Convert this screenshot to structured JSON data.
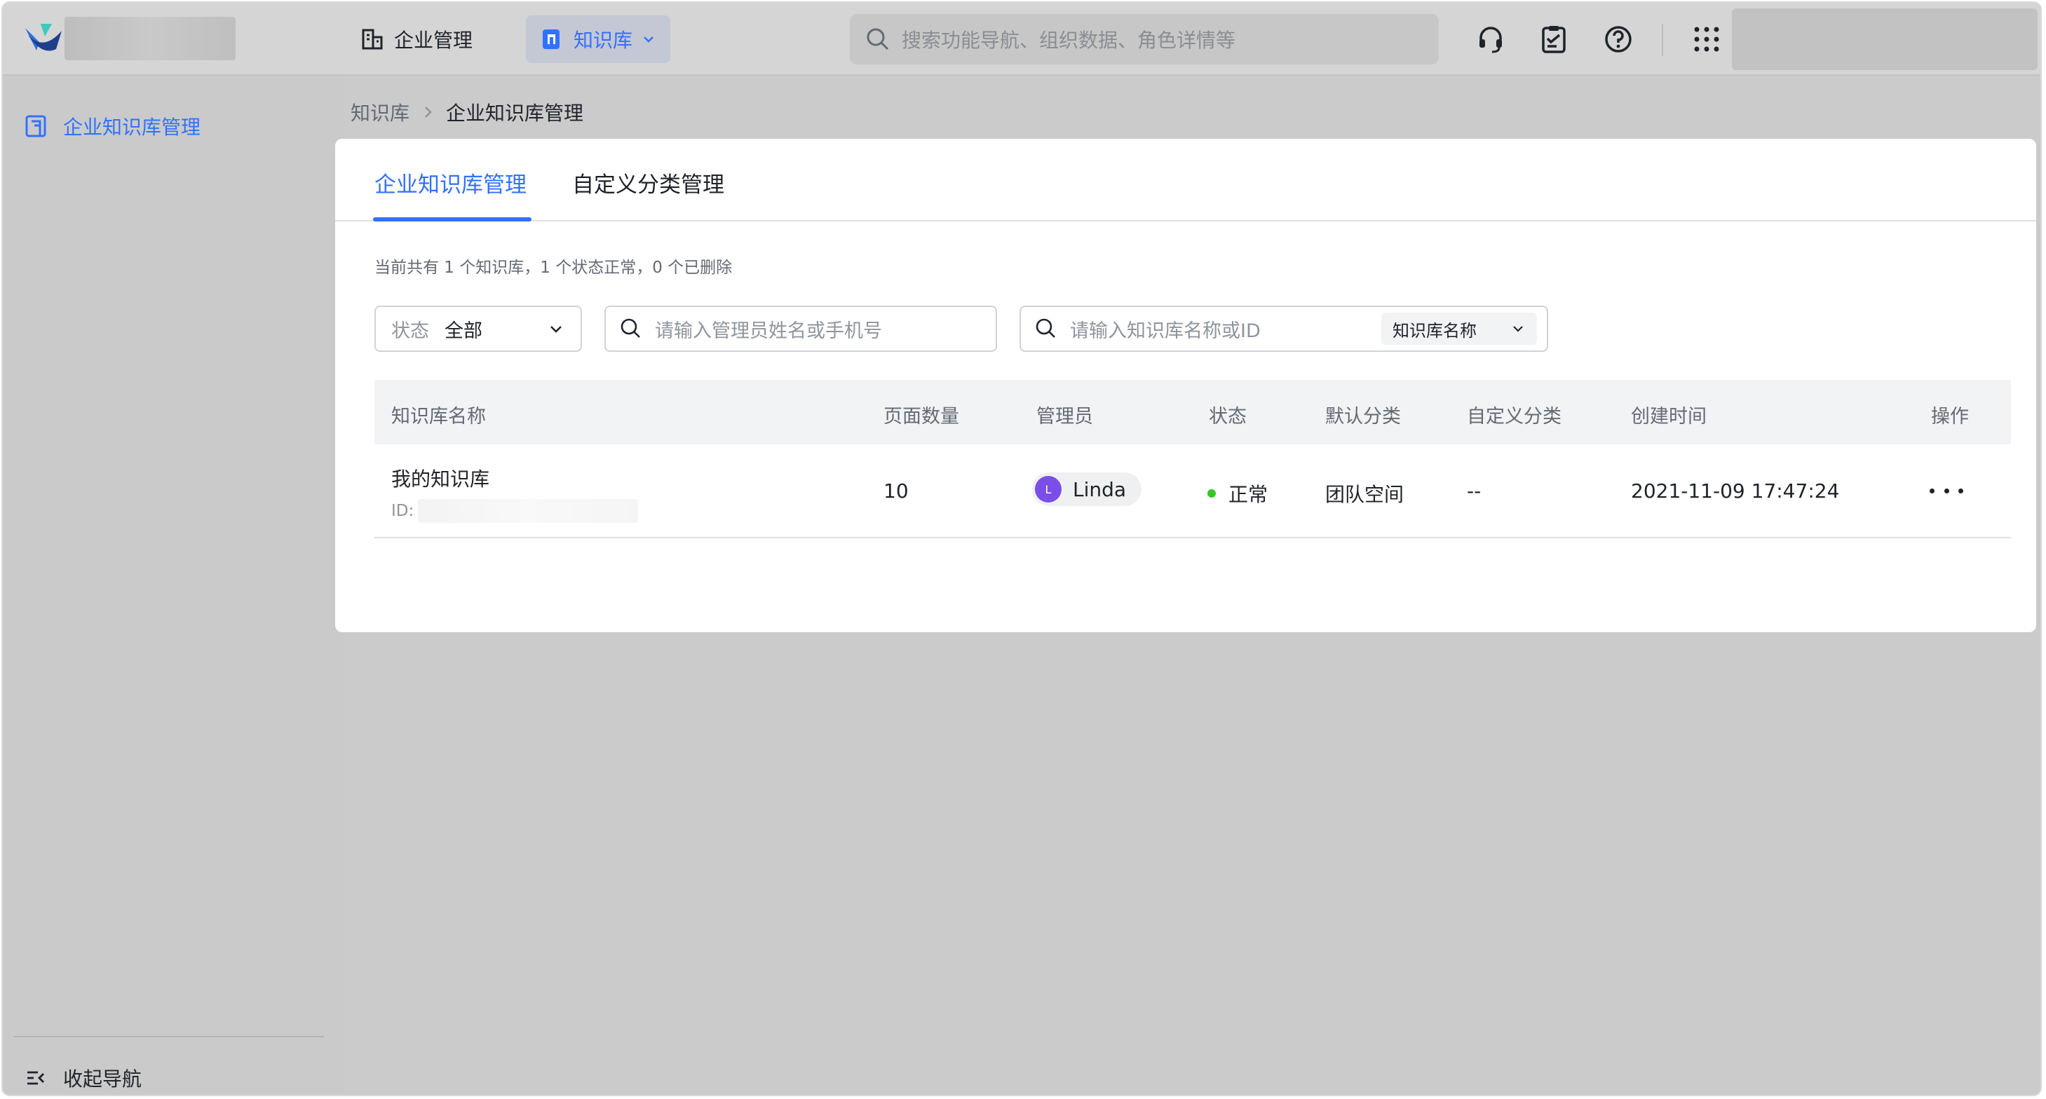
{
  "header": {
    "nav_enterprise": "企业管理",
    "nav_knowledge": "知识库",
    "search_placeholder": "搜索功能导航、组织数据、角色详情等"
  },
  "sidebar": {
    "item_label": "企业知识库管理",
    "collapse_label": "收起导航"
  },
  "breadcrumb": {
    "root": "知识库",
    "current": "企业知识库管理"
  },
  "tabs": {
    "active": "企业知识库管理",
    "second": "自定义分类管理"
  },
  "summary": "当前共有 1 个知识库，1 个状态正常，0 个已删除",
  "filters": {
    "status_label": "状态",
    "status_value": "全部",
    "admin_placeholder": "请输入管理员姓名或手机号",
    "kb_placeholder": "请输入知识库名称或ID",
    "kb_type": "知识库名称"
  },
  "table": {
    "headers": [
      "知识库名称",
      "页面数量",
      "管理员",
      "状态",
      "默认分类",
      "自定义分类",
      "创建时间",
      "操作"
    ],
    "rows": [
      {
        "name": "我的知识库",
        "id_label": "ID:",
        "pages": "10",
        "admin_initial": "L",
        "admin": "Linda",
        "status": "正常",
        "default_category": "团队空间",
        "custom_category": "--",
        "created": "2021-11-09 17:47:24"
      }
    ]
  },
  "colors": {
    "accent": "#3370ff",
    "status_ok": "#34c724",
    "avatar": "#7b4ee7"
  }
}
